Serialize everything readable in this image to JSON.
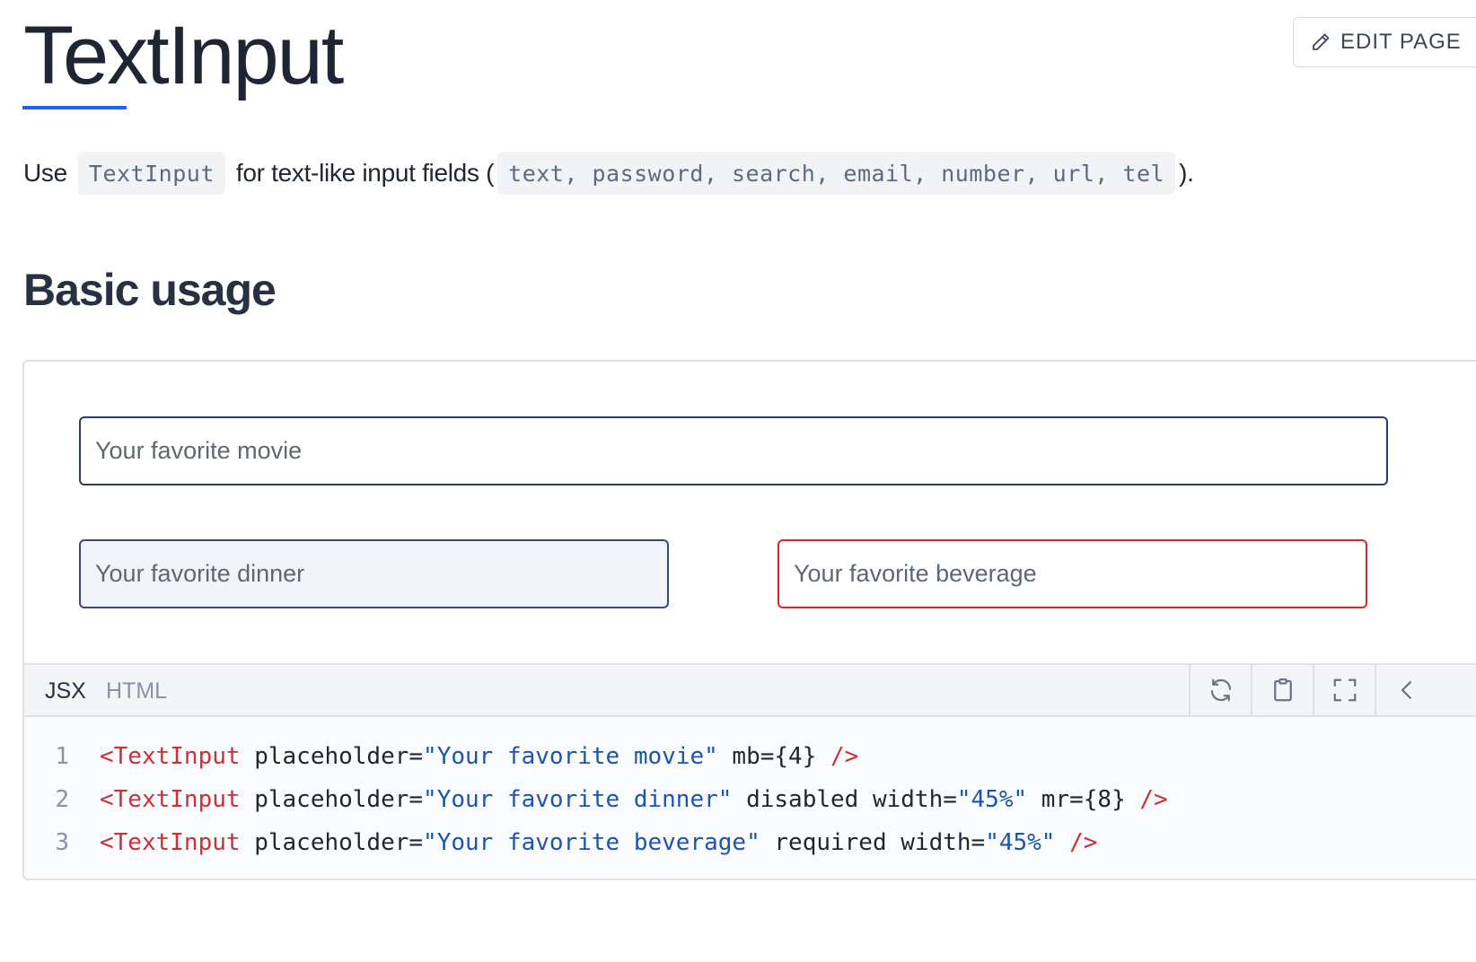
{
  "page": {
    "title": "TextInput",
    "edit_button": "EDIT PAGE",
    "intro": {
      "use": "Use",
      "component": "TextInput",
      "middle": "for text-like input fields (",
      "types": "text, password, search, email, number, url, tel",
      "end": ")."
    },
    "section_title": "Basic usage"
  },
  "demo": {
    "inputs": {
      "movie": {
        "placeholder": "Your favorite movie"
      },
      "dinner": {
        "placeholder": "Your favorite dinner",
        "disabled": true
      },
      "beverage": {
        "placeholder": "Your favorite beverage",
        "required": true
      }
    },
    "tabs": {
      "jsx": "JSX",
      "html": "HTML"
    },
    "toolbar_icons": [
      "refresh-icon",
      "clipboard-icon",
      "fullscreen-icon",
      "chevron-left-icon"
    ],
    "code": [
      {
        "num": "1",
        "tag": "<TextInput",
        "a1": " placeholder=",
        "s1": "\"Your favorite movie\"",
        "a2": " mb={4} ",
        "end": "/>"
      },
      {
        "num": "2",
        "tag": "<TextInput",
        "a1": " placeholder=",
        "s1": "\"Your favorite dinner\"",
        "a2": " disabled width=",
        "s2": "\"45%\"",
        "a3": " mr={8} ",
        "end": "/>"
      },
      {
        "num": "3",
        "tag": "<TextInput",
        "a1": " placeholder=",
        "s1": "\"Your favorite beverage\"",
        "a2": " required width=",
        "s2": "\"45%\"",
        "a3": " ",
        "end": "/>"
      }
    ]
  },
  "colors": {
    "accent": "#1d63ed",
    "input_border": "#2e3a72",
    "required_border": "#d9262d",
    "disabled_bg": "#f2f4fc",
    "code_tag": "#cc2f36",
    "code_string": "#1a55b3"
  }
}
